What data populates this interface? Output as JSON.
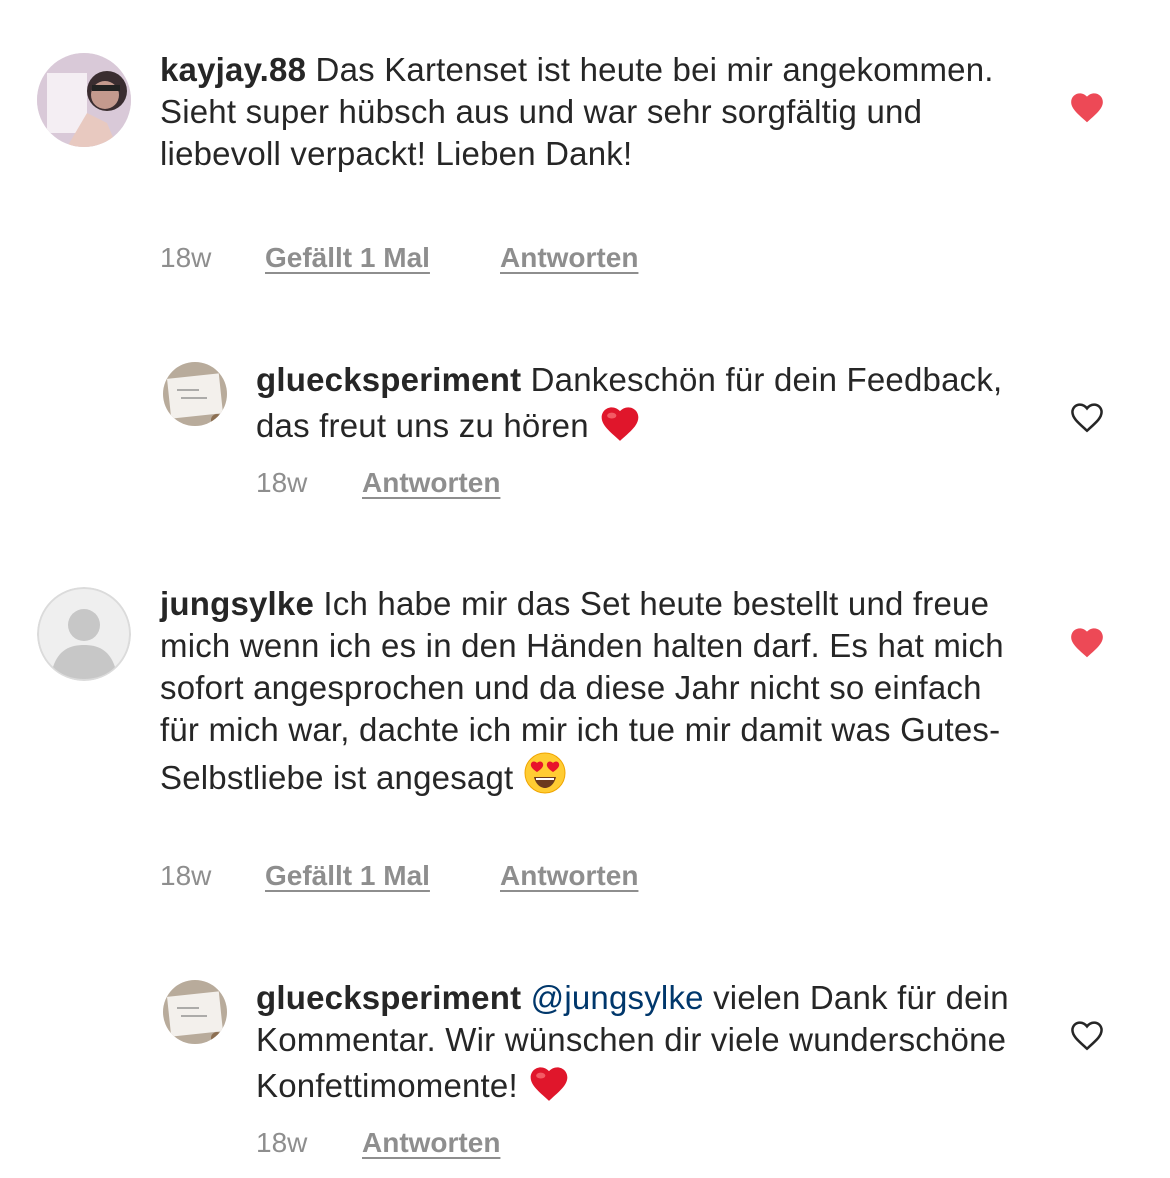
{
  "comments": [
    {
      "username": "kayjay.88",
      "text": "Das Kartenset ist heute bei mir angekommen. Sieht super hübsch aus und war sehr sorgfältig und liebevoll verpackt! Lieben Dank!",
      "time": "18w",
      "likes": "Gefällt 1 Mal",
      "reply": "Antworten",
      "liked": true
    },
    {
      "username": "gluecksperiment",
      "text": "Dankeschön für dein Feedback, das freut uns zu hören",
      "time": "18w",
      "reply": "Antworten",
      "liked": false
    },
    {
      "username": "jungsylke",
      "text": "Ich habe mir das Set heute bestellt und freue mich wenn ich es in den Händen halten darf. Es hat mich sofort angesprochen und da diese Jahr nicht so einfach für mich war, dachte ich mir ich tue mir damit was Gutes- Selbstliebe ist angesagt",
      "time": "18w",
      "likes": "Gefällt 1 Mal",
      "reply": "Antworten",
      "liked": true
    },
    {
      "username": "gluecksperiment",
      "mention": "@jungsylke",
      "text": "vielen Dank für dein Kommentar. Wir wünschen dir viele wunderschöne Konfettimomente!",
      "time": "18w",
      "reply": "Antworten",
      "liked": false
    }
  ],
  "colors": {
    "liked_heart": "#ed4956",
    "meta_text": "#8e8e8e",
    "mention": "#00376b"
  },
  "icons": {
    "liked": "heart-filled-icon",
    "unliked": "heart-outline-icon",
    "emoji_heart": "red-heart-emoji",
    "emoji_heart_eyes": "heart-eyes-emoji"
  }
}
